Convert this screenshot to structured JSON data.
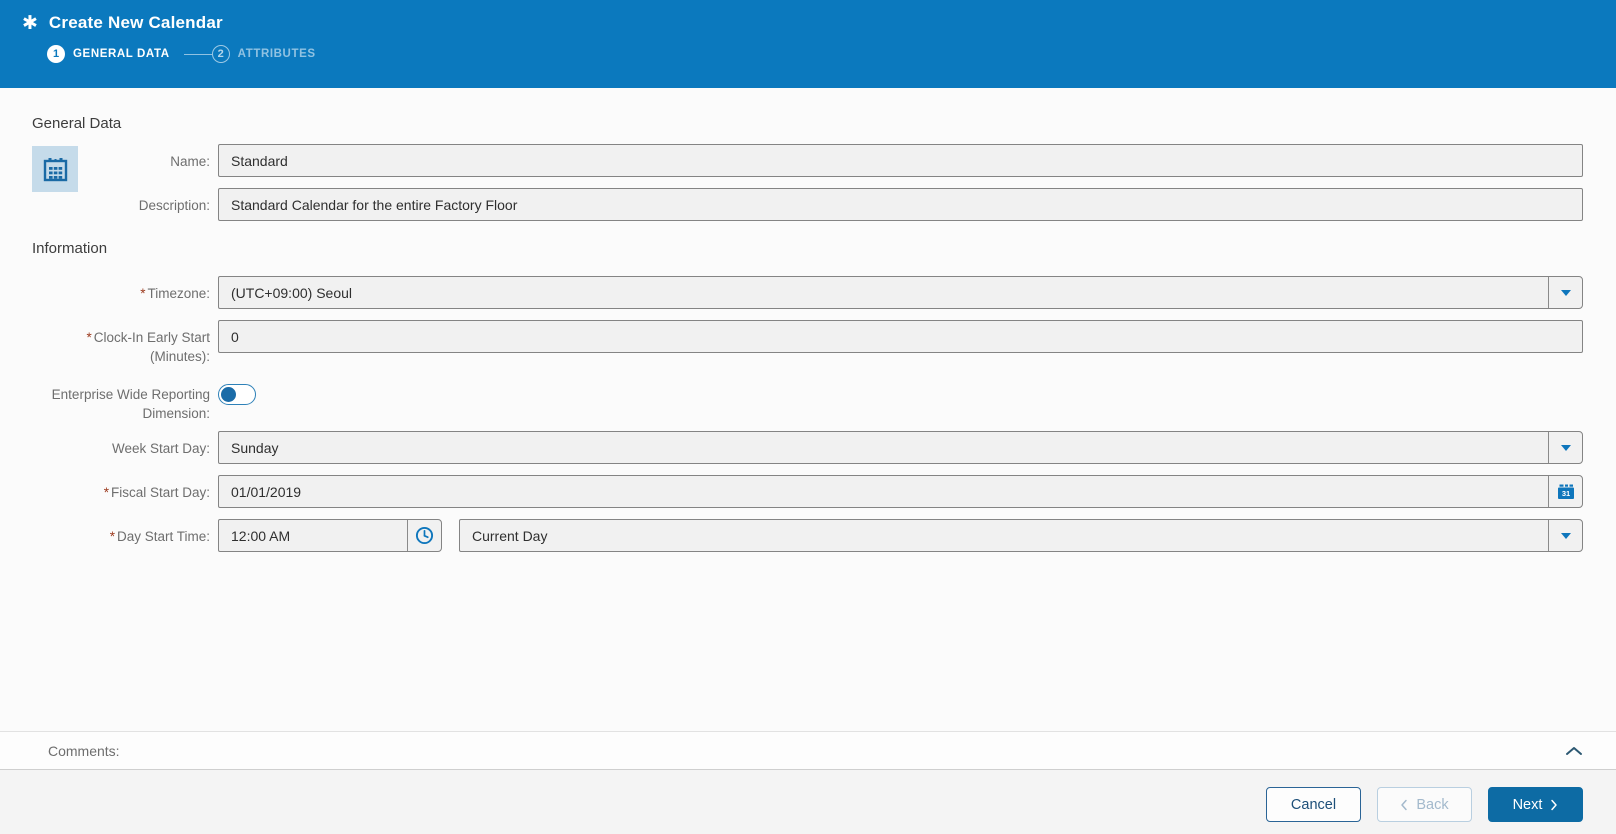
{
  "header": {
    "title": "Create New Calendar",
    "step1": {
      "number": "1",
      "label": "GENERAL DATA"
    },
    "step2": {
      "number": "2",
      "label": "ATTRIBUTES"
    }
  },
  "general": {
    "heading": "General Data",
    "name_label": "Name:",
    "name_value": "Standard",
    "description_label": "Description:",
    "description_value": "Standard Calendar for the entire Factory Floor"
  },
  "information": {
    "heading": "Information",
    "timezone_label": "Timezone:",
    "timezone_value": "(UTC+09:00) Seoul",
    "clockin_label": "Clock-In Early Start (Minutes):",
    "clockin_value": "0",
    "enterprise_label": "Enterprise Wide Reporting Dimension:",
    "enterprise_toggle_state": "off",
    "weekstart_label": "Week Start Day:",
    "weekstart_value": "Sunday",
    "fiscal_label": "Fiscal Start Day:",
    "fiscal_value": "01/01/2019",
    "daystart_label": "Day Start Time:",
    "daystart_time_value": "12:00 AM",
    "daystart_mode_value": "Current Day"
  },
  "ui": {
    "required_marker": "*"
  },
  "comments": {
    "label": "Comments:"
  },
  "footer": {
    "cancel_label": "Cancel",
    "back_label": "Back",
    "next_label": "Next"
  },
  "colors": {
    "header_blue": "#0b79be",
    "accent_blue": "#0e76bc",
    "next_button_blue": "#0d6ba4",
    "required_red": "#9c3a1e",
    "input_background": "#f1f1f1",
    "input_border": "#848484",
    "icon_tile_background": "#c5dbea"
  }
}
